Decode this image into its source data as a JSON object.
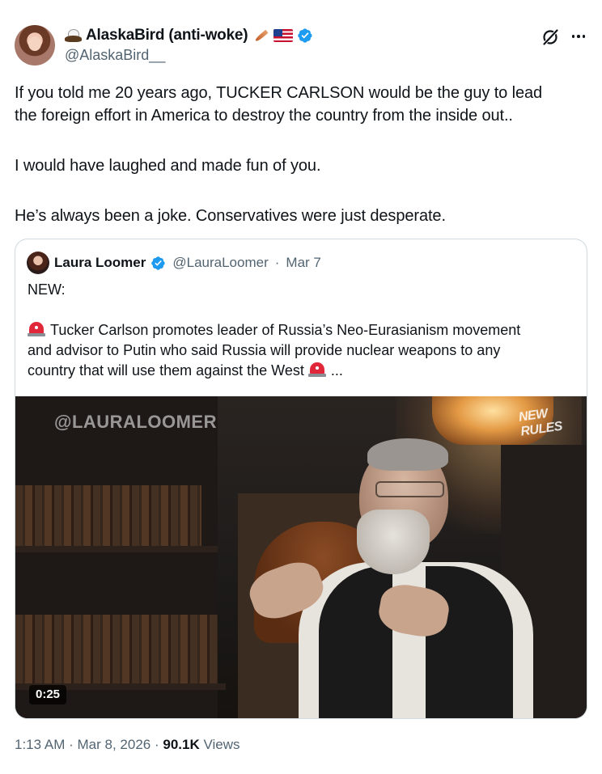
{
  "author": {
    "display_name": "AlaskaBird (anti-woke)",
    "handle": "@AlaskaBird__",
    "emojis": [
      "eagle-icon",
      "feather-icon",
      "us-flag-icon"
    ],
    "verified": true
  },
  "tweet": {
    "paragraphs": [
      "If you told me 20 years ago, TUCKER CARLSON would be the guy to lead\nthe foreign effort in America to destroy the country from the inside out..",
      "I would have laughed and made fun of you.",
      "He’s always been a joke. Conservatives were just desperate."
    ]
  },
  "quote": {
    "display_name": "Laura Loomer",
    "handle": "@LauraLoomer",
    "separator": "·",
    "date": "Mar 7",
    "line1": "NEW:",
    "line2": "Tucker Carlson promotes leader of Russia’s Neo-Eurasianism movement\nand advisor to Putin who said Russia will provide nuclear weapons to any\ncountry that will use them against the West",
    "ellipsis": "...",
    "video": {
      "watermark": "@LAURALOOMER",
      "logo_text": "NEW RULES",
      "duration": "0:25"
    }
  },
  "meta": {
    "time": "1:13 AM",
    "dot": "·",
    "date": "Mar 8, 2026",
    "views_count": "90.1K",
    "views_label": "Views"
  },
  "colors": {
    "verified_blue": "#1d9bf0",
    "secondary_text": "#536471",
    "primary_text": "#0f1419",
    "border": "#cfd9de"
  }
}
